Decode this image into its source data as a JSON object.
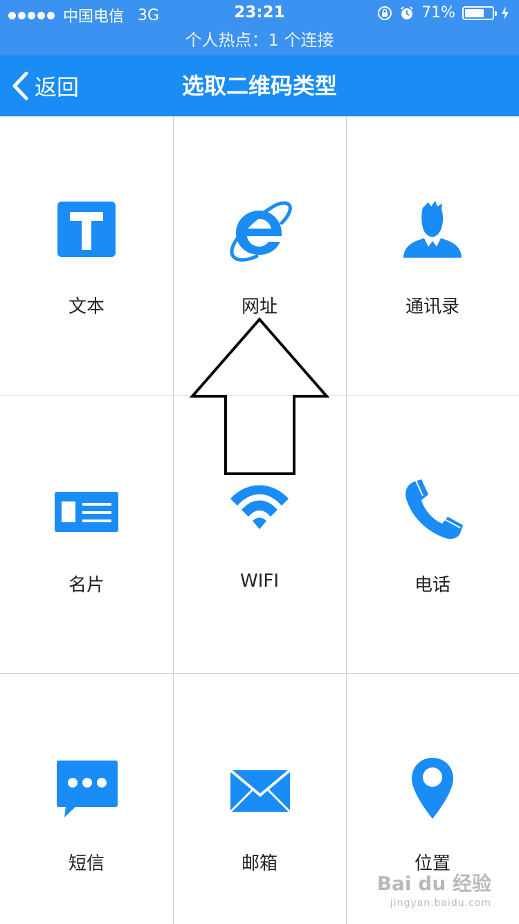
{
  "status_bar": {
    "carrier": "中国电信",
    "network": "3G",
    "time": "23:21",
    "battery": "71%",
    "battery_level": 0.71,
    "icons": [
      "orientation-lock-icon",
      "alarm-icon",
      "battery-icon",
      "charging-icon"
    ]
  },
  "hotspot": {
    "text": "个人热点：1 个连接"
  },
  "nav": {
    "back_label": "返回",
    "title": "选取二维码类型"
  },
  "grid": {
    "items": [
      {
        "label": "文本",
        "icon": "text-icon"
      },
      {
        "label": "网址",
        "icon": "web-browser-icon"
      },
      {
        "label": "通讯录",
        "icon": "contact-icon"
      },
      {
        "label": "名片",
        "icon": "business-card-icon"
      },
      {
        "label": "WIFI",
        "icon": "wifi-icon"
      },
      {
        "label": "电话",
        "icon": "phone-icon"
      },
      {
        "label": "短信",
        "icon": "message-icon"
      },
      {
        "label": "邮箱",
        "icon": "mail-icon"
      },
      {
        "label": "位置",
        "icon": "location-pin-icon"
      }
    ]
  },
  "watermark": {
    "brand": "Bai du 经验",
    "url": "jingyan.baidu.com"
  },
  "colors": {
    "primary": "#1a8cf5",
    "status_bar": "#3b92f0",
    "grid_line": "#cfcfcf",
    "text": "#222222"
  }
}
